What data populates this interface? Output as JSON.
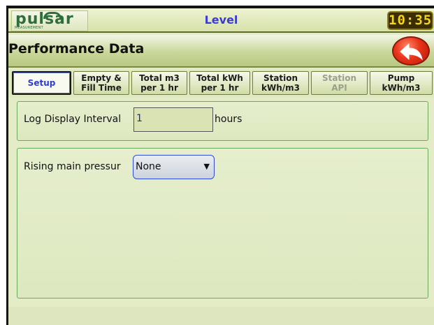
{
  "app": {
    "logo_text": "pulsar",
    "logo_subtext": "MEASUREMENT",
    "title": "Level",
    "clock": "10:35"
  },
  "header": {
    "page_title": "Performance Data"
  },
  "tabs": [
    {
      "label": "Setup",
      "state": "active"
    },
    {
      "label": "Empty &\nFill Time",
      "state": "normal"
    },
    {
      "label": "Total m3\nper 1 hr",
      "state": "normal"
    },
    {
      "label": "Total kWh\nper 1 hr",
      "state": "normal"
    },
    {
      "label": "Station\nkWh/m3",
      "state": "normal"
    },
    {
      "label": "Station\nAPI",
      "state": "disabled"
    },
    {
      "label": "Pump\nkWh/m3",
      "state": "normal"
    }
  ],
  "log_display": {
    "label": "Log Display Interval",
    "value": "1",
    "unit": "hours"
  },
  "rising_main": {
    "label": "Rising main pressur",
    "selected": "None"
  },
  "colors": {
    "accent_blue": "#3a3ad6",
    "panel_border": "#6aaa5a",
    "clock_text": "#f5d51a",
    "back_button": "#e8341a"
  },
  "icons": {
    "back": "back-arrow-icon"
  }
}
